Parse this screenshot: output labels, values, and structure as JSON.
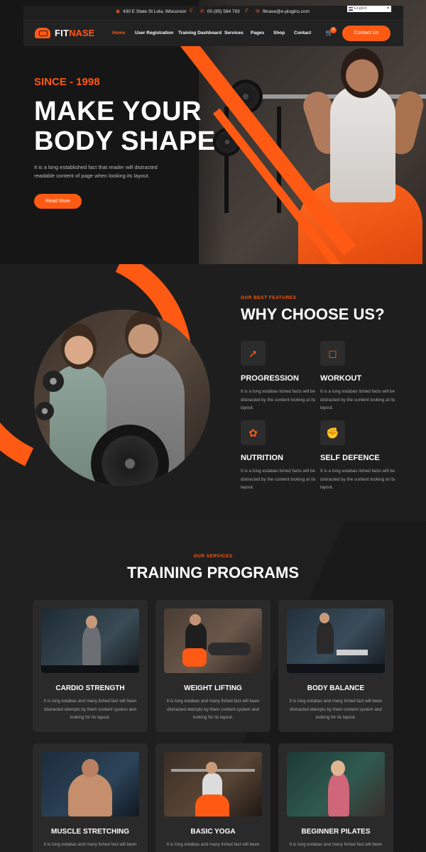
{
  "topbar": {
    "address": "430 E State St Lola, Wisconsin",
    "phone": "00 (85) 584 793",
    "email": "fitnase@e-plugins.com",
    "separator": "//",
    "language": "English"
  },
  "nav": {
    "logo_part1": "FIT",
    "logo_part2": "NASE",
    "items": [
      "Home",
      "User Registration",
      "Training Dashboard",
      "Services",
      "Pages",
      "Shop",
      "Contact"
    ],
    "cart_count": "0",
    "contact_button": "Contact Us"
  },
  "hero": {
    "since": "SINCE - 1998",
    "title_line1": "MAKE YOUR",
    "title_line2": "BODY SHAPE",
    "description": "It is a long established fact that reader will distracted readable content of page when looking its layout.",
    "button": "Read More"
  },
  "why": {
    "kicker": "OUR BEST FEATURES",
    "title": "WHY CHOOSE US?",
    "features": [
      {
        "title": "PROGRESSION",
        "text": "It is a long estabas lished facts will be distracted by the content looking at its layout.",
        "icon": "progression-icon"
      },
      {
        "title": "WORKOUT",
        "text": "It is a long estabas lished facts will be distracted by the content looking at its layout.",
        "icon": "dumbbell-icon"
      },
      {
        "title": "NUTRITION",
        "text": "It is a long estabas lished facts will be distracted by the content looking at its layout.",
        "icon": "nutrition-icon"
      },
      {
        "title": "SELF DEFENCE",
        "text": "It is a long estabas lished facts will be distracted by the content looking at its layout.",
        "icon": "self-defence-icon"
      }
    ]
  },
  "programs": {
    "kicker": "OUR SERVICES",
    "title": "TRAINING PROGRAMS",
    "cards": [
      {
        "title": "CARDIO STRENGTH",
        "text": "It is long estabas and many lished fact will been distracted etempts by them content system and looking for its layout."
      },
      {
        "title": "WEIGHT LIFTING",
        "text": "It is long estabas and many lished fact will been distracted etempts by them content system and looking for its layout."
      },
      {
        "title": "BODY BALANCE",
        "text": "It is long estabas and many lished fact will been distracted etempts by them content system and looking for its layout."
      },
      {
        "title": "MUSCLE STRETCHING",
        "text": "It is long estabas and many lished fact will been"
      },
      {
        "title": "BASIC YOGA",
        "text": "It is long estabas and many lished fact will been"
      },
      {
        "title": "BEGINNER PILATES",
        "text": "It is long estabas and many lished fact will been"
      }
    ]
  },
  "colors": {
    "accent": "#ff5a14",
    "background": "#1c1c1c",
    "card": "#2a2a2a"
  }
}
